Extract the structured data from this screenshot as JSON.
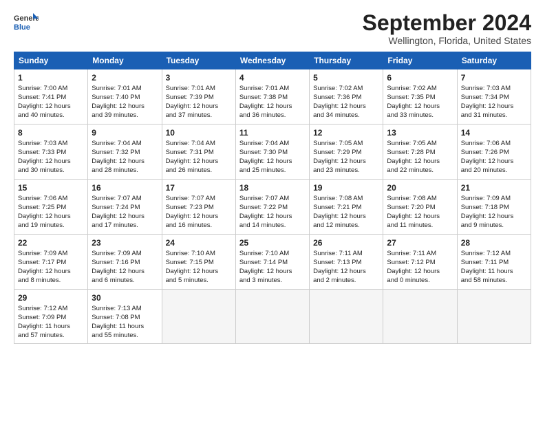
{
  "logo": {
    "line1": "General",
    "line2": "Blue"
  },
  "title": "September 2024",
  "subtitle": "Wellington, Florida, United States",
  "headers": [
    "Sunday",
    "Monday",
    "Tuesday",
    "Wednesday",
    "Thursday",
    "Friday",
    "Saturday"
  ],
  "weeks": [
    [
      {
        "day": "1",
        "info": "Sunrise: 7:00 AM\nSunset: 7:41 PM\nDaylight: 12 hours\nand 40 minutes."
      },
      {
        "day": "2",
        "info": "Sunrise: 7:01 AM\nSunset: 7:40 PM\nDaylight: 12 hours\nand 39 minutes."
      },
      {
        "day": "3",
        "info": "Sunrise: 7:01 AM\nSunset: 7:39 PM\nDaylight: 12 hours\nand 37 minutes."
      },
      {
        "day": "4",
        "info": "Sunrise: 7:01 AM\nSunset: 7:38 PM\nDaylight: 12 hours\nand 36 minutes."
      },
      {
        "day": "5",
        "info": "Sunrise: 7:02 AM\nSunset: 7:36 PM\nDaylight: 12 hours\nand 34 minutes."
      },
      {
        "day": "6",
        "info": "Sunrise: 7:02 AM\nSunset: 7:35 PM\nDaylight: 12 hours\nand 33 minutes."
      },
      {
        "day": "7",
        "info": "Sunrise: 7:03 AM\nSunset: 7:34 PM\nDaylight: 12 hours\nand 31 minutes."
      }
    ],
    [
      {
        "day": "8",
        "info": "Sunrise: 7:03 AM\nSunset: 7:33 PM\nDaylight: 12 hours\nand 30 minutes."
      },
      {
        "day": "9",
        "info": "Sunrise: 7:04 AM\nSunset: 7:32 PM\nDaylight: 12 hours\nand 28 minutes."
      },
      {
        "day": "10",
        "info": "Sunrise: 7:04 AM\nSunset: 7:31 PM\nDaylight: 12 hours\nand 26 minutes."
      },
      {
        "day": "11",
        "info": "Sunrise: 7:04 AM\nSunset: 7:30 PM\nDaylight: 12 hours\nand 25 minutes."
      },
      {
        "day": "12",
        "info": "Sunrise: 7:05 AM\nSunset: 7:29 PM\nDaylight: 12 hours\nand 23 minutes."
      },
      {
        "day": "13",
        "info": "Sunrise: 7:05 AM\nSunset: 7:28 PM\nDaylight: 12 hours\nand 22 minutes."
      },
      {
        "day": "14",
        "info": "Sunrise: 7:06 AM\nSunset: 7:26 PM\nDaylight: 12 hours\nand 20 minutes."
      }
    ],
    [
      {
        "day": "15",
        "info": "Sunrise: 7:06 AM\nSunset: 7:25 PM\nDaylight: 12 hours\nand 19 minutes."
      },
      {
        "day": "16",
        "info": "Sunrise: 7:07 AM\nSunset: 7:24 PM\nDaylight: 12 hours\nand 17 minutes."
      },
      {
        "day": "17",
        "info": "Sunrise: 7:07 AM\nSunset: 7:23 PM\nDaylight: 12 hours\nand 16 minutes."
      },
      {
        "day": "18",
        "info": "Sunrise: 7:07 AM\nSunset: 7:22 PM\nDaylight: 12 hours\nand 14 minutes."
      },
      {
        "day": "19",
        "info": "Sunrise: 7:08 AM\nSunset: 7:21 PM\nDaylight: 12 hours\nand 12 minutes."
      },
      {
        "day": "20",
        "info": "Sunrise: 7:08 AM\nSunset: 7:20 PM\nDaylight: 12 hours\nand 11 minutes."
      },
      {
        "day": "21",
        "info": "Sunrise: 7:09 AM\nSunset: 7:18 PM\nDaylight: 12 hours\nand 9 minutes."
      }
    ],
    [
      {
        "day": "22",
        "info": "Sunrise: 7:09 AM\nSunset: 7:17 PM\nDaylight: 12 hours\nand 8 minutes."
      },
      {
        "day": "23",
        "info": "Sunrise: 7:09 AM\nSunset: 7:16 PM\nDaylight: 12 hours\nand 6 minutes."
      },
      {
        "day": "24",
        "info": "Sunrise: 7:10 AM\nSunset: 7:15 PM\nDaylight: 12 hours\nand 5 minutes."
      },
      {
        "day": "25",
        "info": "Sunrise: 7:10 AM\nSunset: 7:14 PM\nDaylight: 12 hours\nand 3 minutes."
      },
      {
        "day": "26",
        "info": "Sunrise: 7:11 AM\nSunset: 7:13 PM\nDaylight: 12 hours\nand 2 minutes."
      },
      {
        "day": "27",
        "info": "Sunrise: 7:11 AM\nSunset: 7:12 PM\nDaylight: 12 hours\nand 0 minutes."
      },
      {
        "day": "28",
        "info": "Sunrise: 7:12 AM\nSunset: 7:11 PM\nDaylight: 11 hours\nand 58 minutes."
      }
    ],
    [
      {
        "day": "29",
        "info": "Sunrise: 7:12 AM\nSunset: 7:09 PM\nDaylight: 11 hours\nand 57 minutes."
      },
      {
        "day": "30",
        "info": "Sunrise: 7:13 AM\nSunset: 7:08 PM\nDaylight: 11 hours\nand 55 minutes."
      },
      {
        "day": "",
        "info": ""
      },
      {
        "day": "",
        "info": ""
      },
      {
        "day": "",
        "info": ""
      },
      {
        "day": "",
        "info": ""
      },
      {
        "day": "",
        "info": ""
      }
    ]
  ]
}
